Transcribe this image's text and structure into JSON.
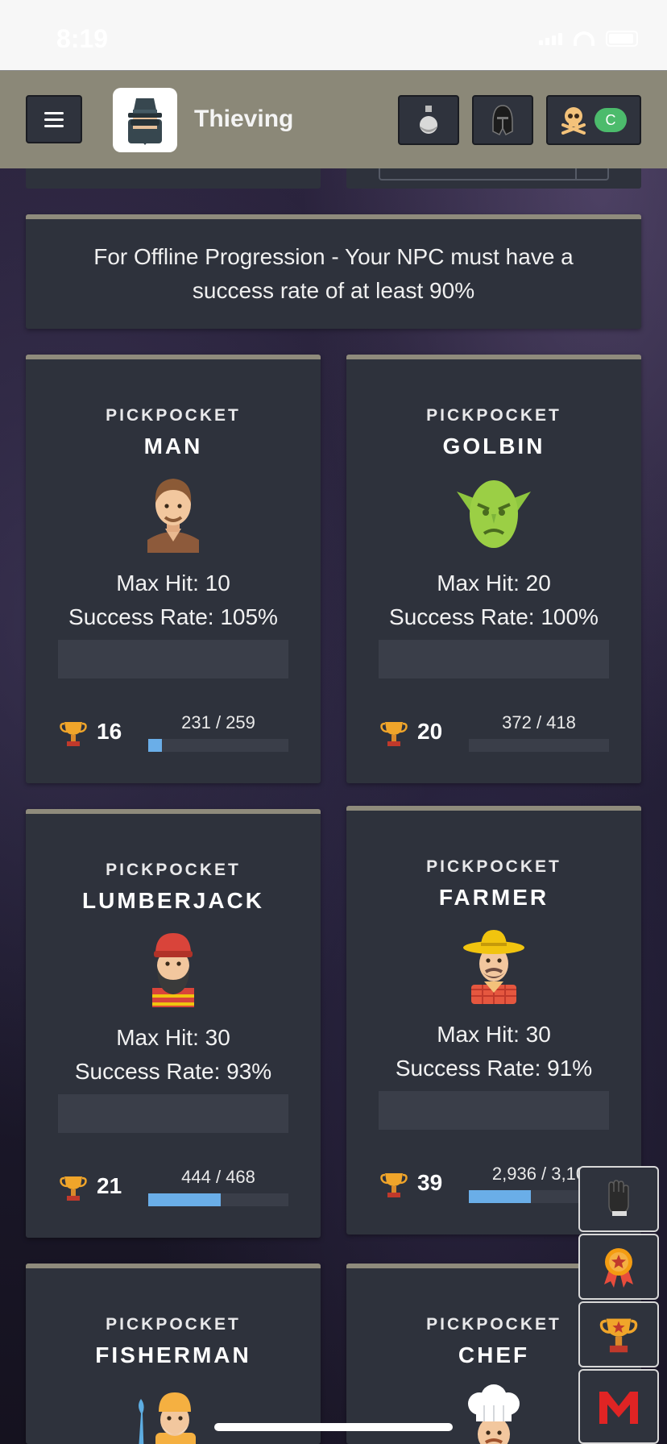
{
  "status_bar": {
    "time": "8:19"
  },
  "header": {
    "title": "Thieving",
    "combat_level_badge": "C",
    "buttons": [
      "potion-icon",
      "equipment-helmet-icon",
      "skull-crossbones-icon"
    ]
  },
  "info": {
    "offline_text": "For Offline Progression - Your NPC must have a success rate of at least 90%"
  },
  "npcs": [
    {
      "kicker": "PICKPOCKET",
      "name": "MAN",
      "max_hit": "Max Hit: 10",
      "success": "Success Rate: 105%",
      "mastery": "16",
      "xp": "231 / 259",
      "progress": 0.1,
      "icon": "man-avatar-icon"
    },
    {
      "kicker": "PICKPOCKET",
      "name": "GOLBIN",
      "max_hit": "Max Hit: 20",
      "success": "Success Rate: 100%",
      "mastery": "20",
      "xp": "372 / 418",
      "progress": 0.0,
      "icon": "golbin-avatar-icon"
    },
    {
      "kicker": "PICKPOCKET",
      "name": "LUMBERJACK",
      "max_hit": "Max Hit: 30",
      "success": "Success Rate: 93%",
      "mastery": "21",
      "xp": "444 / 468",
      "progress": 0.52,
      "icon": "lumberjack-avatar-icon"
    },
    {
      "kicker": "PICKPOCKET",
      "name": "FARMER",
      "max_hit": "Max Hit: 30",
      "success": "Success Rate: 91%",
      "mastery": "39",
      "xp": "2,936 / 3,10",
      "progress": 0.44,
      "icon": "farmer-avatar-icon"
    },
    {
      "kicker": "PICKPOCKET",
      "name": "FISHERMAN",
      "icon": "fisherman-avatar-icon"
    },
    {
      "kicker": "PICKPOCKET",
      "name": "CHEF",
      "icon": "chef-avatar-icon"
    }
  ],
  "side_buttons": [
    "thieving-glove-icon",
    "mastery-medal-icon",
    "trophy-icon",
    "melvor-logo-icon"
  ],
  "colors": {
    "header": "#8b8878",
    "panel": "#2e323c",
    "xp_fill": "#6aaee8",
    "combat_badge": "#4cbb6c"
  }
}
